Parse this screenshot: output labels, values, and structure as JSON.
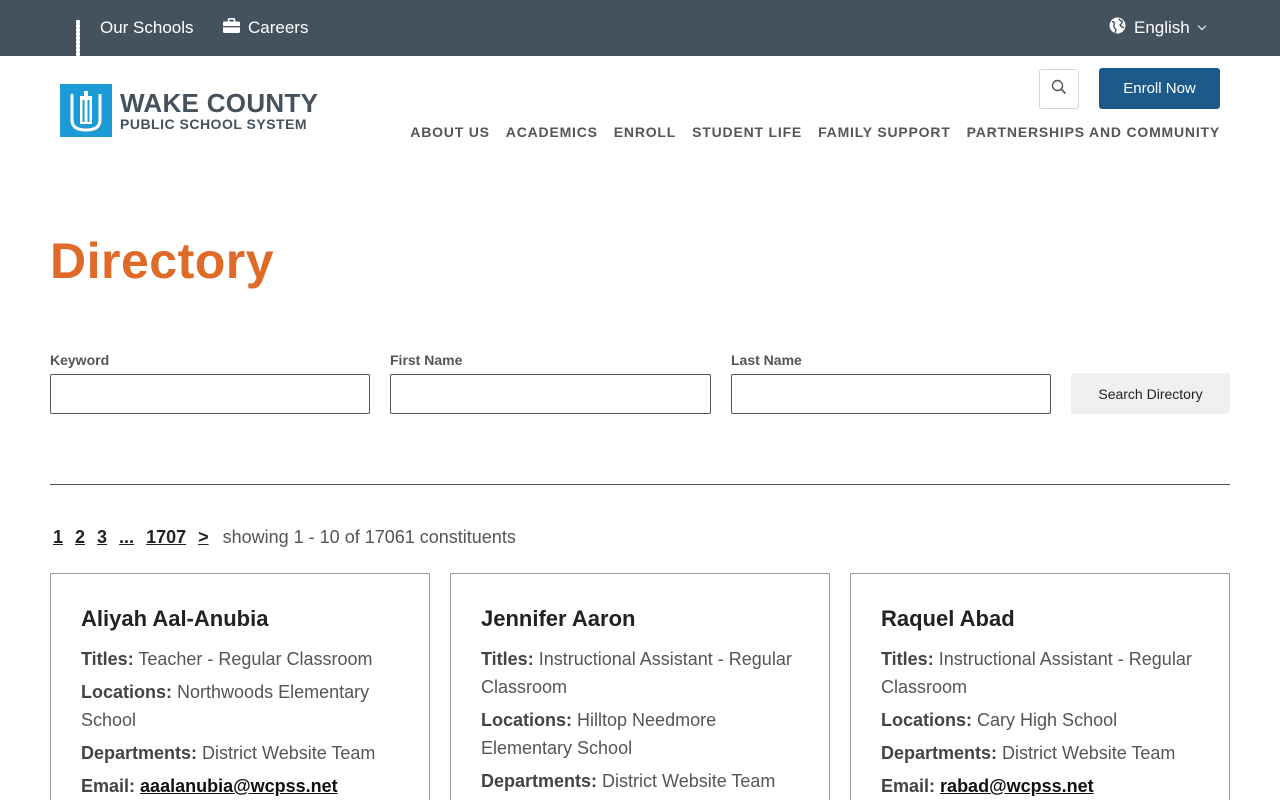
{
  "topbar": {
    "our_schools": "Our Schools",
    "careers": "Careers",
    "language": "English"
  },
  "header": {
    "logo_line1": "WAKE COUNTY",
    "logo_line2": "PUBLIC SCHOOL SYSTEM",
    "enroll_label": "Enroll Now",
    "nav": [
      "ABOUT US",
      "ACADEMICS",
      "ENROLL",
      "STUDENT LIFE",
      "FAMILY SUPPORT",
      "PARTNERSHIPS AND COMMUNITY"
    ]
  },
  "page": {
    "title": "Directory"
  },
  "search": {
    "keyword_label": "Keyword",
    "keyword_value": "",
    "first_label": "First Name",
    "first_value": "",
    "last_label": "Last Name",
    "last_value": "",
    "button_label": "Search Directory"
  },
  "pager": {
    "pages": [
      "1",
      "2",
      "3",
      "...",
      "1707",
      ">"
    ],
    "showing": "showing 1 - 10 of 17061 constituents"
  },
  "labels": {
    "titles": "Titles:",
    "locations": "Locations:",
    "departments": "Departments:",
    "email": "Email:"
  },
  "cards": [
    {
      "name": "Aliyah Aal-Anubia",
      "titles": "Teacher - Regular Classroom",
      "locations": "Northwoods Elementary School",
      "departments": "District Website Team",
      "email": "aaalanubia@wcpss.net"
    },
    {
      "name": "Jennifer Aaron",
      "titles": "Instructional Assistant - Regular Classroom",
      "locations": "Hilltop Needmore Elementary School",
      "departments": "District Website Team",
      "email": ""
    },
    {
      "name": "Raquel Abad",
      "titles": "Instructional Assistant - Regular Classroom",
      "locations": "Cary High School",
      "departments": "District Website Team",
      "email": "rabad@wcpss.net"
    }
  ]
}
